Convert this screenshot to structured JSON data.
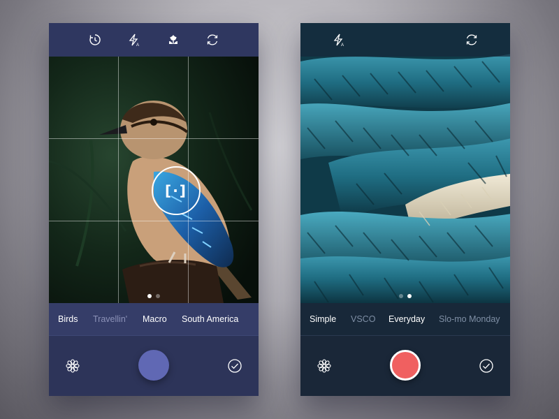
{
  "left_screen": {
    "toolbar": [
      "timer-icon",
      "flash-auto-icon",
      "macro-icon",
      "switch-camera-icon"
    ],
    "filters": [
      {
        "label": "Birds",
        "active": true
      },
      {
        "label": "Travellin'",
        "active": false
      },
      {
        "label": "Macro",
        "active": true
      },
      {
        "label": "South America",
        "active": true
      }
    ],
    "focus_symbol": "[·]",
    "page_indicator": {
      "current": 1,
      "total": 2
    },
    "shutter_color": "#6068b4"
  },
  "right_screen": {
    "toolbar": [
      "flash-auto-icon",
      "switch-camera-icon"
    ],
    "filters": [
      {
        "label": "Simple",
        "active": true
      },
      {
        "label": "VSCO",
        "active": false
      },
      {
        "label": "Everyday",
        "active": true
      },
      {
        "label": "Slo-mo Monday",
        "active": false
      }
    ],
    "page_indicator": {
      "current": 2,
      "total": 2
    },
    "shutter_color": "#f06060"
  },
  "colors": {
    "left_panel": "#2d3459",
    "right_panel": "#1a2738",
    "accent_blue": "#6068b4",
    "accent_red": "#f06060"
  }
}
